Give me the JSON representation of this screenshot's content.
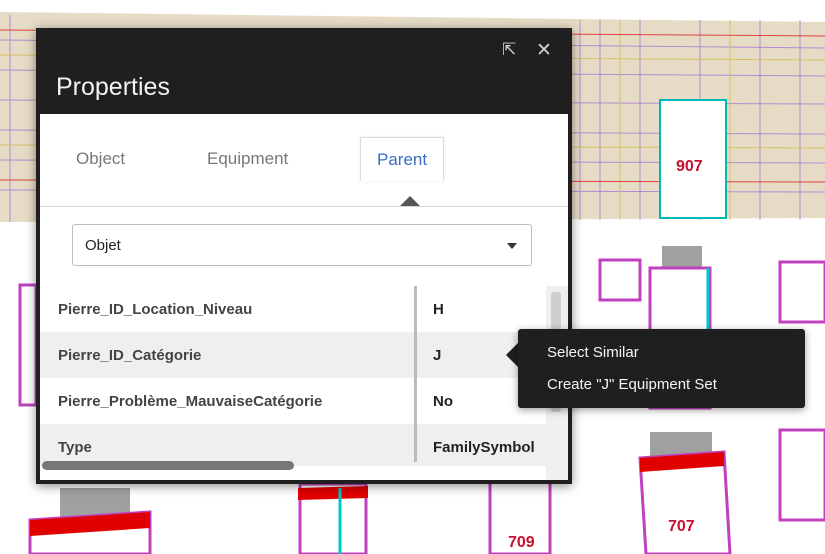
{
  "panel": {
    "title": "Properties",
    "popout_icon": "popout-arrow-icon",
    "close_icon": "close-icon",
    "popout_glyph": "⇱",
    "close_glyph": "✕"
  },
  "tabs": [
    {
      "label": "Object",
      "active": false
    },
    {
      "label": "Equipment",
      "active": false
    },
    {
      "label": "Parent",
      "active": true
    }
  ],
  "category_select": {
    "selected": "Objet"
  },
  "properties": [
    {
      "name": "Pierre_ID_Location_Niveau",
      "value": "H"
    },
    {
      "name": "Pierre_ID_Catégorie",
      "value": "J"
    },
    {
      "name": "Pierre_Problème_MauvaiseCatégorie",
      "value": "No"
    },
    {
      "name": "Type",
      "value": "FamilySymbol"
    }
  ],
  "context_menu": {
    "items": [
      "Select Similar",
      "Create \"J\" Equipment Set"
    ]
  },
  "viewport": {
    "tags": [
      "907",
      "707",
      "709"
    ]
  },
  "colors": {
    "panel_bg": "#1f1f1f",
    "active_tab": "#3a6dc5",
    "tag_text": "#c8102e",
    "wall_fill": "#e8dcc4",
    "magenta_outline": "#c040c0",
    "red_strip": "#e00000",
    "cyan_edge": "#00c8c8"
  }
}
